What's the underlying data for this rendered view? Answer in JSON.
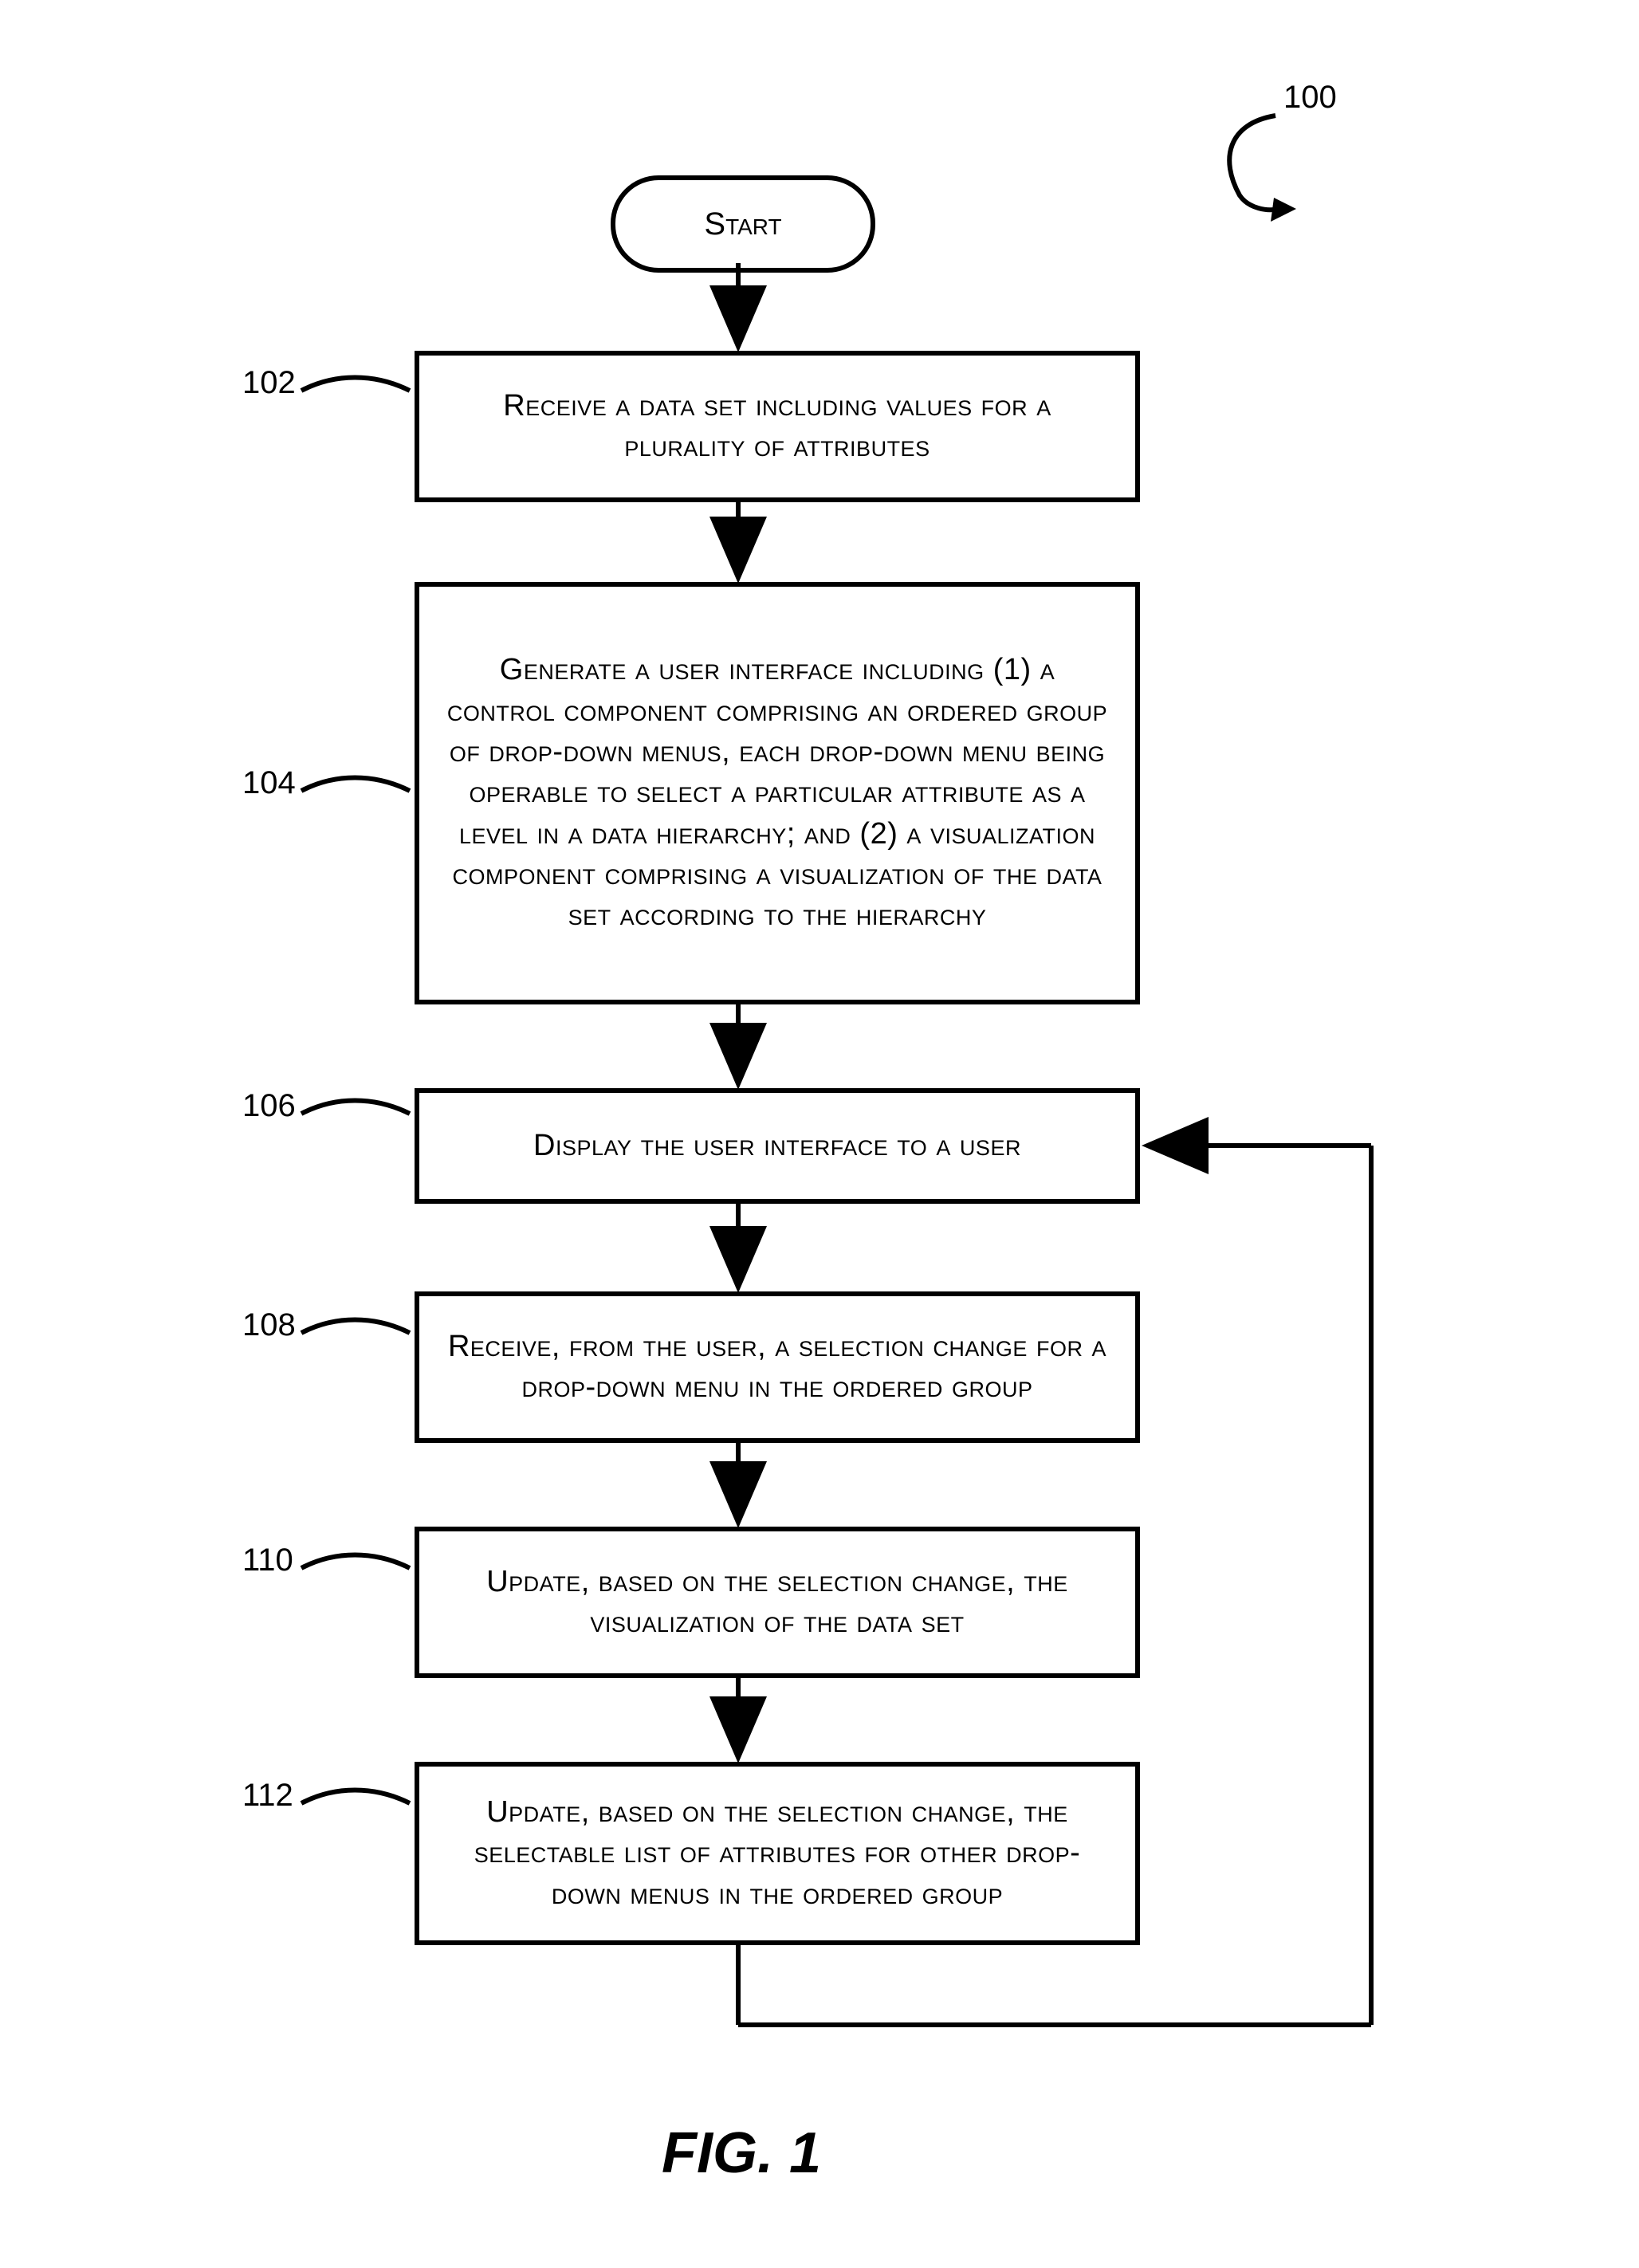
{
  "diagram_ref": "100",
  "start_label": "Start",
  "steps": [
    {
      "ref": "102",
      "text": "Receive a data set including values for a plurality of attributes"
    },
    {
      "ref": "104",
      "text": "Generate a user interface including (1) a control component comprising an ordered group of drop-down menus, each drop-down menu being operable to select a particular attribute as a level in a data hierarchy; and (2) a visualization component comprising a visualization of the data set according to the hierarchy"
    },
    {
      "ref": "106",
      "text": "Display the user interface to a user"
    },
    {
      "ref": "108",
      "text": "Receive, from the user, a selection change for a drop-down menu in the ordered group"
    },
    {
      "ref": "110",
      "text": "Update, based on the selection change, the visualization of the data set"
    },
    {
      "ref": "112",
      "text": "Update, based on the selection change, the selectable list of attributes for other drop-down menus in the ordered group"
    }
  ],
  "figure_caption": "FIG. 1"
}
